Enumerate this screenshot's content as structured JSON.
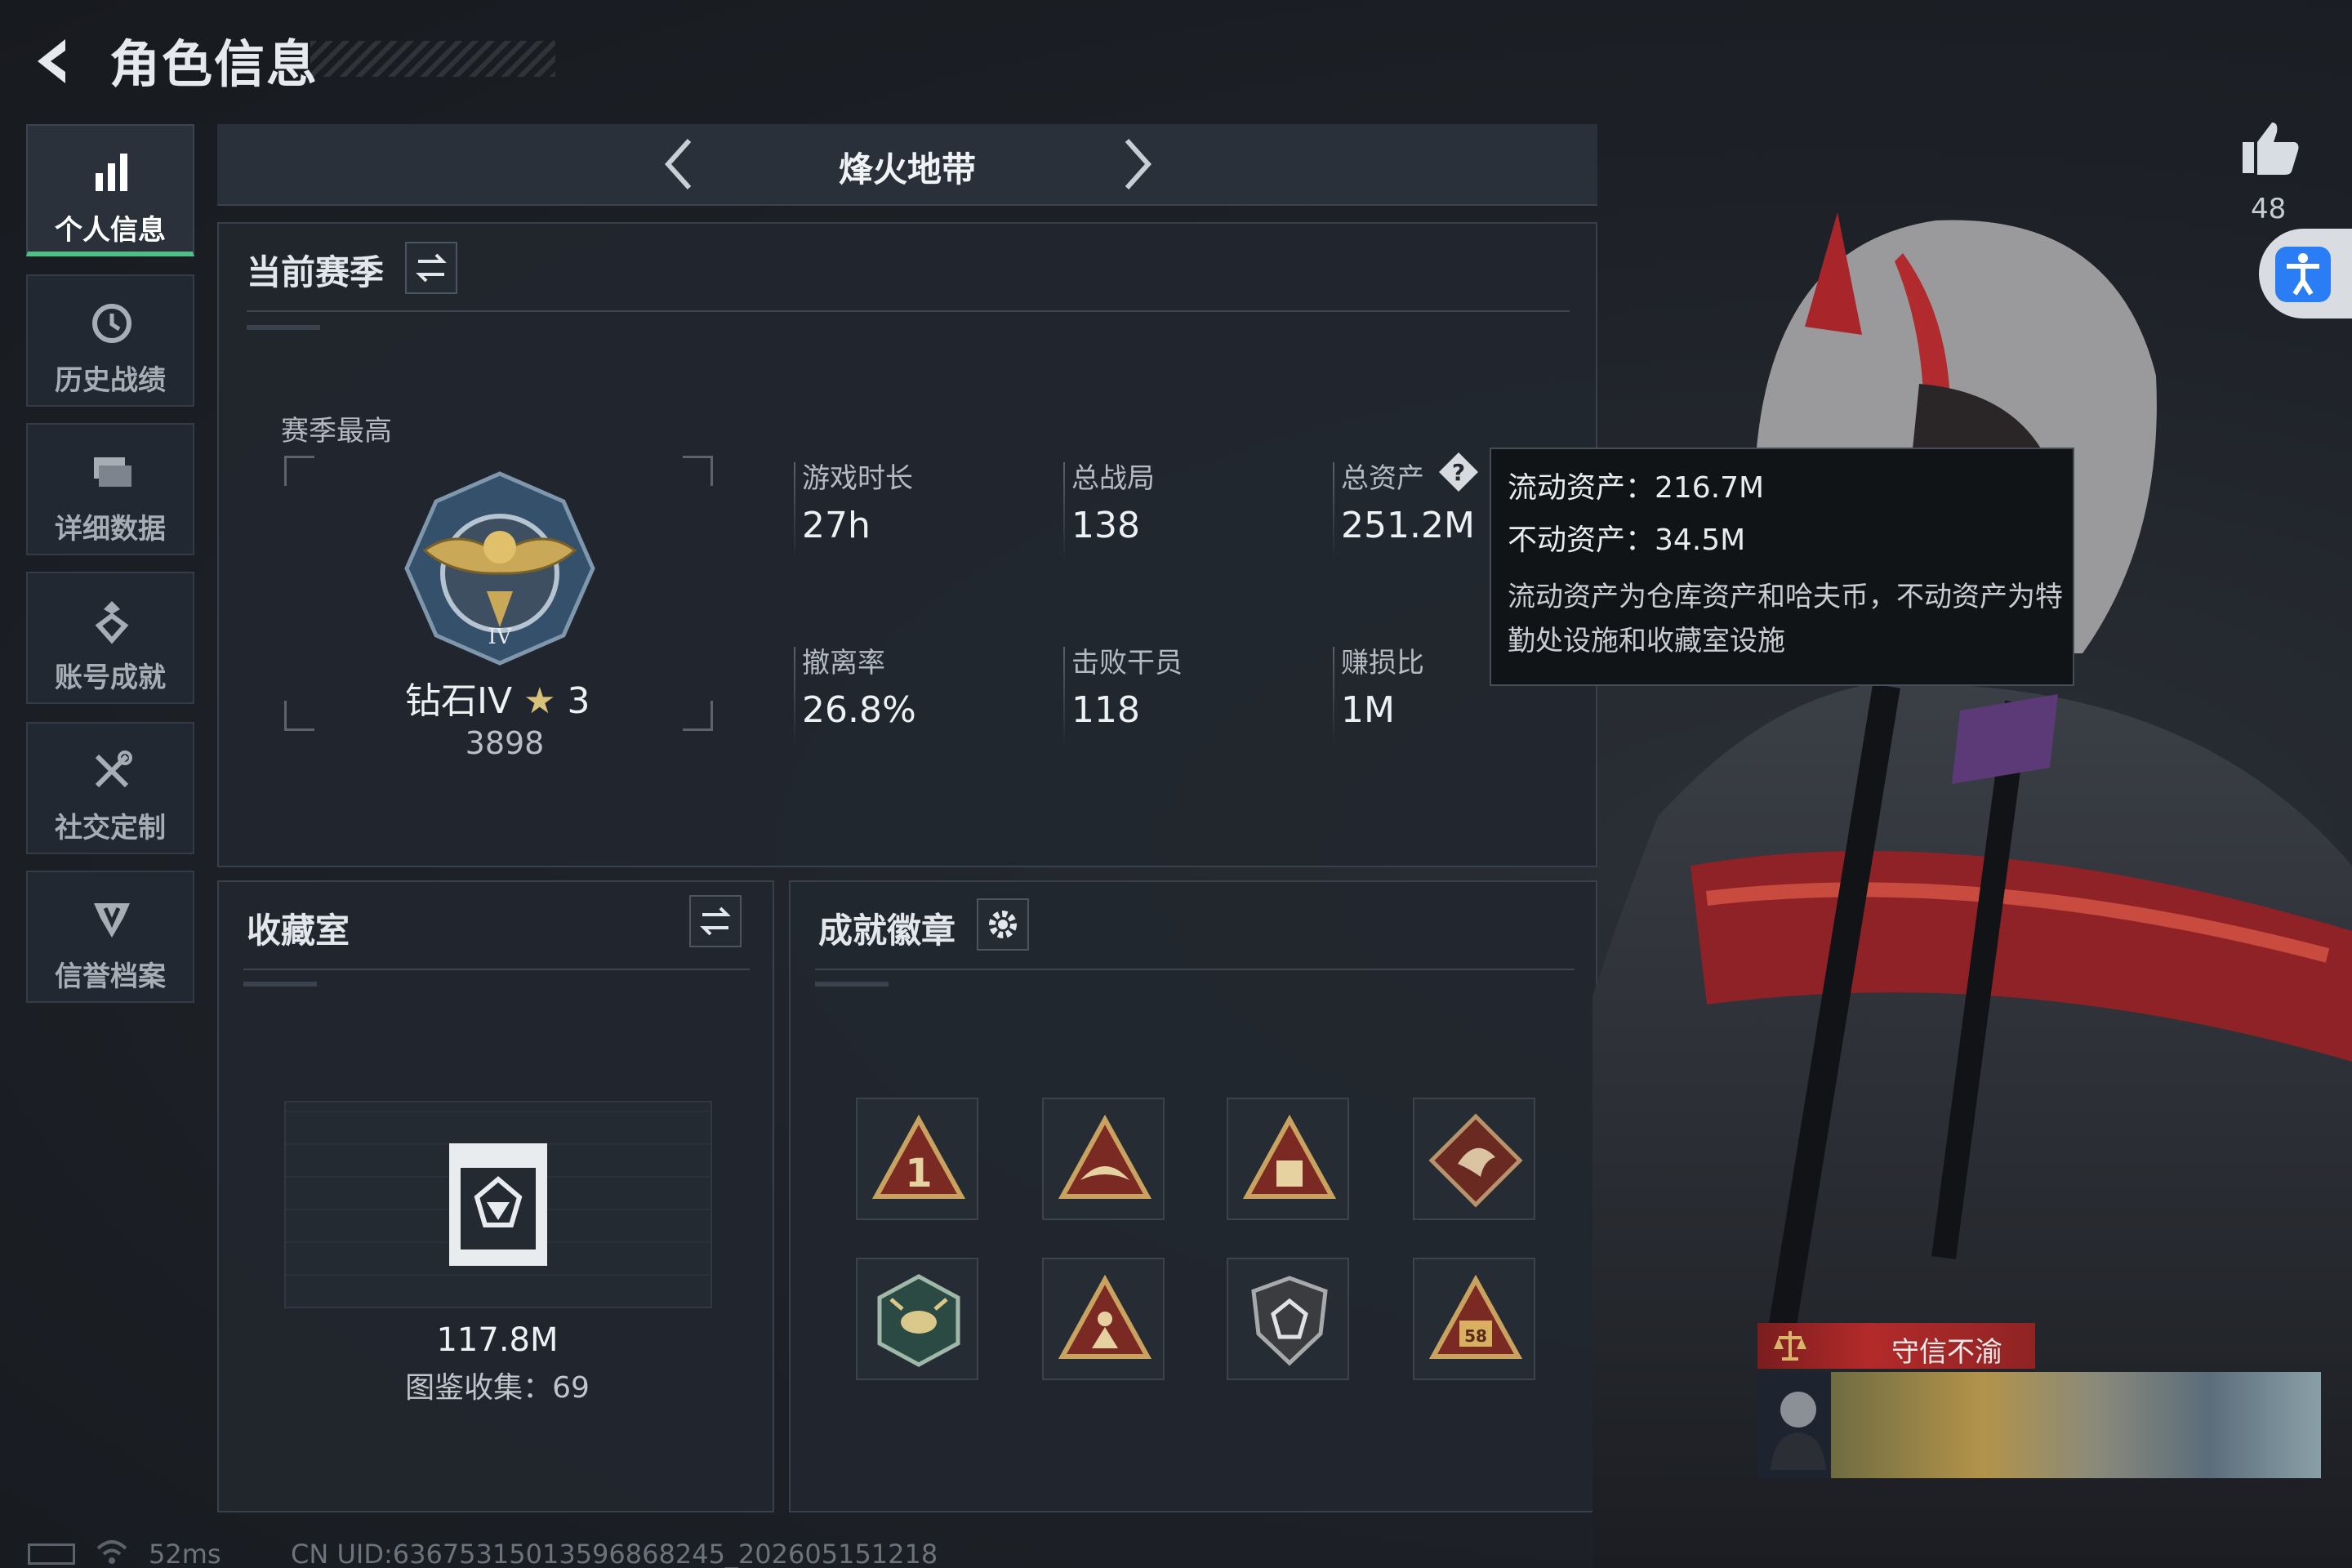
{
  "header": {
    "title": "角色信息"
  },
  "nav": {
    "items": [
      {
        "label": "个人信息",
        "icon": "bar-chart-icon",
        "active": true
      },
      {
        "label": "历史战绩",
        "icon": "history-clock-icon",
        "active": false
      },
      {
        "label": "详细数据",
        "icon": "folders-icon",
        "active": false
      },
      {
        "label": "账号成就",
        "icon": "achievement-medal-icon",
        "active": false
      },
      {
        "label": "社交定制",
        "icon": "tools-icon",
        "active": false
      },
      {
        "label": "信誉档案",
        "icon": "reputation-shield-icon",
        "active": false
      }
    ]
  },
  "mode": {
    "title": "烽火地带"
  },
  "season": {
    "title": "当前赛季",
    "best_label": "赛季最高",
    "rank_name": "钻石IV",
    "rank_star": "3",
    "rank_score": "3898",
    "stats": [
      {
        "label": "游戏时长",
        "value": "27h"
      },
      {
        "label": "总战局",
        "value": "138"
      },
      {
        "label": "总资产",
        "value": "251.2M"
      },
      {
        "label": "撤离率",
        "value": "26.8%"
      },
      {
        "label": "击败干员",
        "value": "118"
      },
      {
        "label": "赚损比",
        "value": "1M"
      }
    ]
  },
  "tooltip": {
    "liquid": "流动资产：216.7M",
    "fixed": "不动资产：34.5M",
    "description": "流动资产为仓库资产和哈夫币，不动资产为特勤处设施和收藏室设施"
  },
  "collection": {
    "title": "收藏室",
    "value": "117.8M",
    "count": "图鉴收集：69"
  },
  "badges": {
    "title": "成就徽章",
    "items": [
      "badge-1",
      "badge-2",
      "badge-3",
      "badge-4",
      "badge-5",
      "badge-6",
      "badge-7",
      "badge-8"
    ]
  },
  "social": {
    "likes": "48",
    "trust_title": "守信不渝"
  },
  "footer": {
    "ping": "52ms",
    "uid": "CN UID:6367531501359686824​5_202605151218"
  },
  "colors": {
    "accent_green": "#4fbf86",
    "banner_red": "#b32a2a",
    "accessibility_blue": "#2a7df5"
  }
}
